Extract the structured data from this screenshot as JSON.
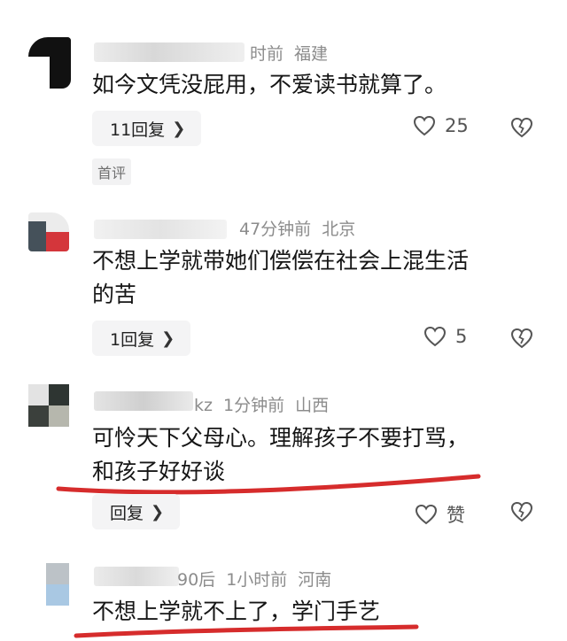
{
  "comments": [
    {
      "meta_time": "时前",
      "meta_region": "福建",
      "text_lines": [
        "如今文凭没屁用，不爱读书就算了。"
      ],
      "reply_label": "11回复",
      "likes": "25",
      "tag": "首评"
    },
    {
      "meta_time": "47分钟前",
      "meta_region": "北京",
      "text_lines": [
        "不想上学就带她们偿偿在社会上混生活",
        "的苦"
      ],
      "reply_label": "1回复",
      "likes": "5"
    },
    {
      "meta_name_tail": "kz",
      "meta_time": "1分钟前",
      "meta_region": "山西",
      "text_lines": [
        "可怜天下父母心。理解孩子不要打骂，",
        "和孩子好好谈"
      ],
      "reply_label": "回复",
      "likes": "赞"
    },
    {
      "meta_name_tail": "90后",
      "meta_time": "1小时前",
      "meta_region": "河南",
      "text_lines": [
        "不想上学就不上了，学门手艺"
      ]
    }
  ],
  "icons": {
    "reply_chevron": "chevron-right-icon",
    "like": "heart-outline-icon",
    "dislike": "broken-heart-icon"
  },
  "colors": {
    "annotation_red": "#d62c2c",
    "reply_bg": "#f4f4f5",
    "meta_gray": "#8c8c8c"
  }
}
